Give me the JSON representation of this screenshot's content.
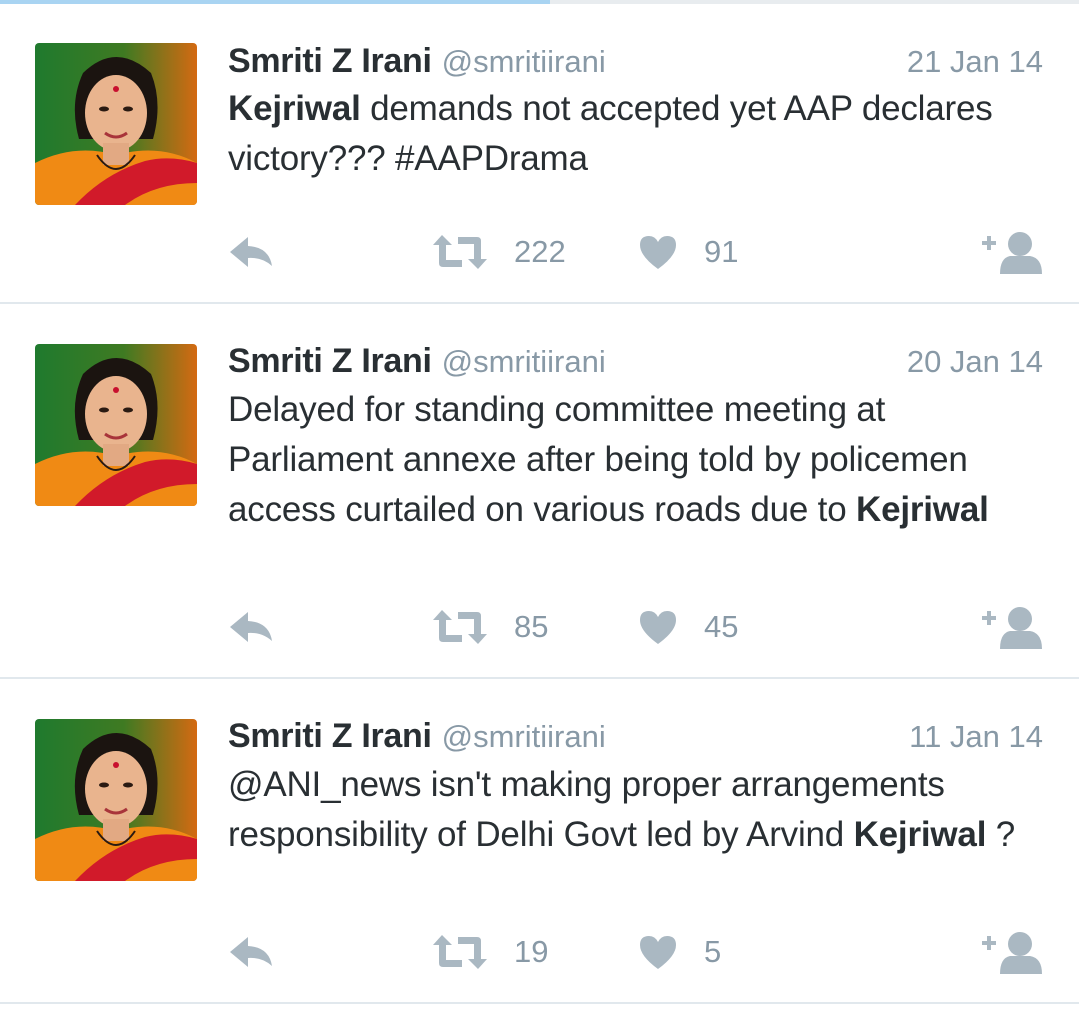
{
  "scroll_progress": 0.51,
  "colors": {
    "text": "#292f33",
    "muted": "#8899a6",
    "icon": "#aab8c2",
    "divider": "#e1e8ed",
    "progress": "#a9d4f2"
  },
  "icons": {
    "reply": "reply-arrow-icon",
    "retweet": "retweet-icon",
    "like": "heart-icon",
    "follow": "follow-user-plus-icon"
  },
  "tweets": [
    {
      "name": "Smriti Z Irani",
      "handle": "@smritiirani",
      "date": "21 Jan 14",
      "text_bold_1": "Kejriwal",
      "text_1": " demands not accepted yet AAP declares victory??? #AAPDrama",
      "retweets": "222",
      "likes": "91"
    },
    {
      "name": "Smriti Z Irani",
      "handle": "@smritiirani",
      "date": "20 Jan 14",
      "text_1": "Delayed for standing committee meeting at Parliament annexe after being told by policemen access curtailed on various roads due to ",
      "text_bold_1": "Kejriwal",
      "retweets": "85",
      "likes": "45"
    },
    {
      "name": "Smriti Z Irani",
      "handle": "@smritiirani",
      "date": "11 Jan 14",
      "text_1": "@ANI_news isn't making proper arrangements responsibility of Delhi Govt led by Arvind ",
      "text_bold_1": "Kejriwal",
      "text_2": " ?",
      "retweets": "19",
      "likes": "5"
    }
  ]
}
